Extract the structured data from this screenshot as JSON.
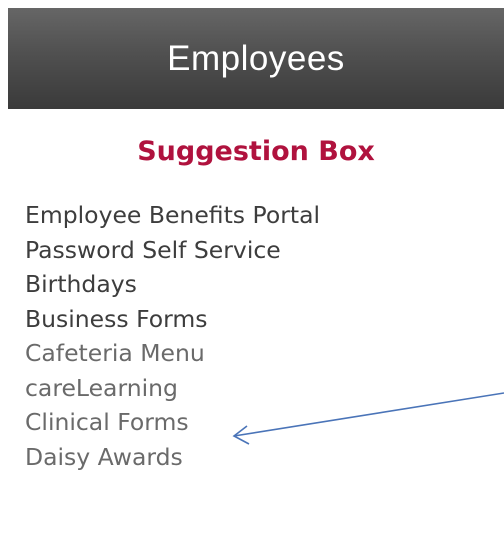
{
  "header": {
    "title": "Employees",
    "background_color": "#505050"
  },
  "suggestion_box": {
    "label": "Suggestion Box",
    "color": "#b0123e"
  },
  "links": [
    {
      "label": "Employee Benefits Portal"
    },
    {
      "label": "Password Self Service"
    },
    {
      "label": "Birthdays"
    },
    {
      "label": "Business Forms"
    },
    {
      "label": "Cafeteria Menu"
    },
    {
      "label": "careLearning"
    },
    {
      "label": "Clinical Forms"
    },
    {
      "label": "Daisy Awards"
    }
  ],
  "annotation": {
    "type": "arrow",
    "points_to": "careLearning",
    "color": "#4a74b8"
  }
}
